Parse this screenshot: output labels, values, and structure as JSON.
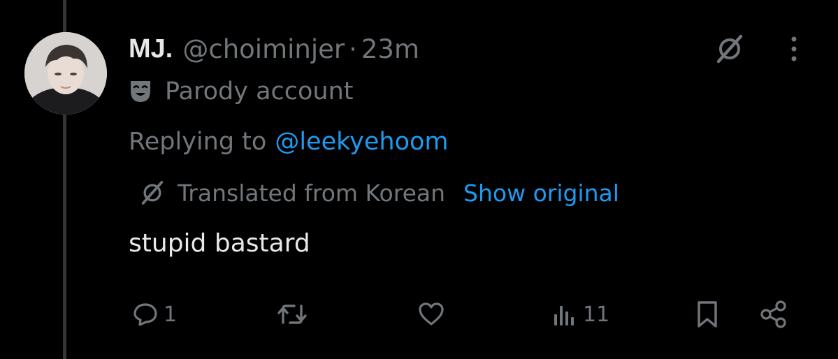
{
  "post": {
    "author": {
      "name": "MJ.",
      "handle": "@choiminjer",
      "separator": "·",
      "time": "23m",
      "badge_label": "Parody account"
    },
    "replying": {
      "prefix": "Replying to",
      "mention": "@leekyehoom"
    },
    "translation": {
      "label": "Translated from Korean",
      "show_original": "Show original"
    },
    "text": "stupid bastard",
    "actions": {
      "replies": "1",
      "views": "11"
    }
  },
  "icons": {
    "grok": "grok-icon",
    "more": "more-vertical-icon",
    "mask": "theater-mask-icon",
    "reply": "reply-icon",
    "repost": "repost-icon",
    "like": "heart-icon",
    "views": "views-icon",
    "bookmark": "bookmark-icon",
    "share": "share-icon"
  },
  "colors": {
    "background": "#000000",
    "primary_text": "#e7e9ea",
    "secondary_text": "#71767b",
    "accent": "#1d9bf0",
    "thread_line": "#333639"
  }
}
